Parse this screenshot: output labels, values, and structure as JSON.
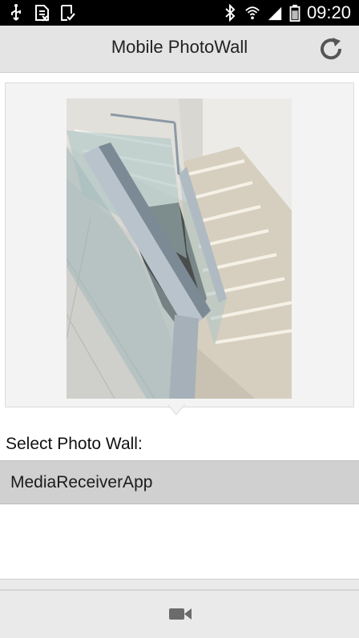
{
  "status_bar": {
    "time": "09:20",
    "left_icons": [
      "usb-icon",
      "sim-card-icon",
      "download-complete-icon"
    ],
    "right_icons": [
      "bluetooth-icon",
      "wifi-icon",
      "signal-icon",
      "battery-icon"
    ]
  },
  "header": {
    "title": "Mobile PhotoWall",
    "refresh_icon": "refresh-icon"
  },
  "main": {
    "select_label": "Select Photo Wall:",
    "walls": [
      {
        "label": "MediaReceiverApp"
      }
    ]
  },
  "bottom_bar": {
    "camera_icon": "video-camera-icon"
  },
  "colors": {
    "status_bar_bg": "#000000",
    "header_bg": "#e4e4e4",
    "card_bg": "#f3f3f3",
    "list_item_bg": "#d0d0d0",
    "bottom_bar_bg": "#eaeaea"
  }
}
